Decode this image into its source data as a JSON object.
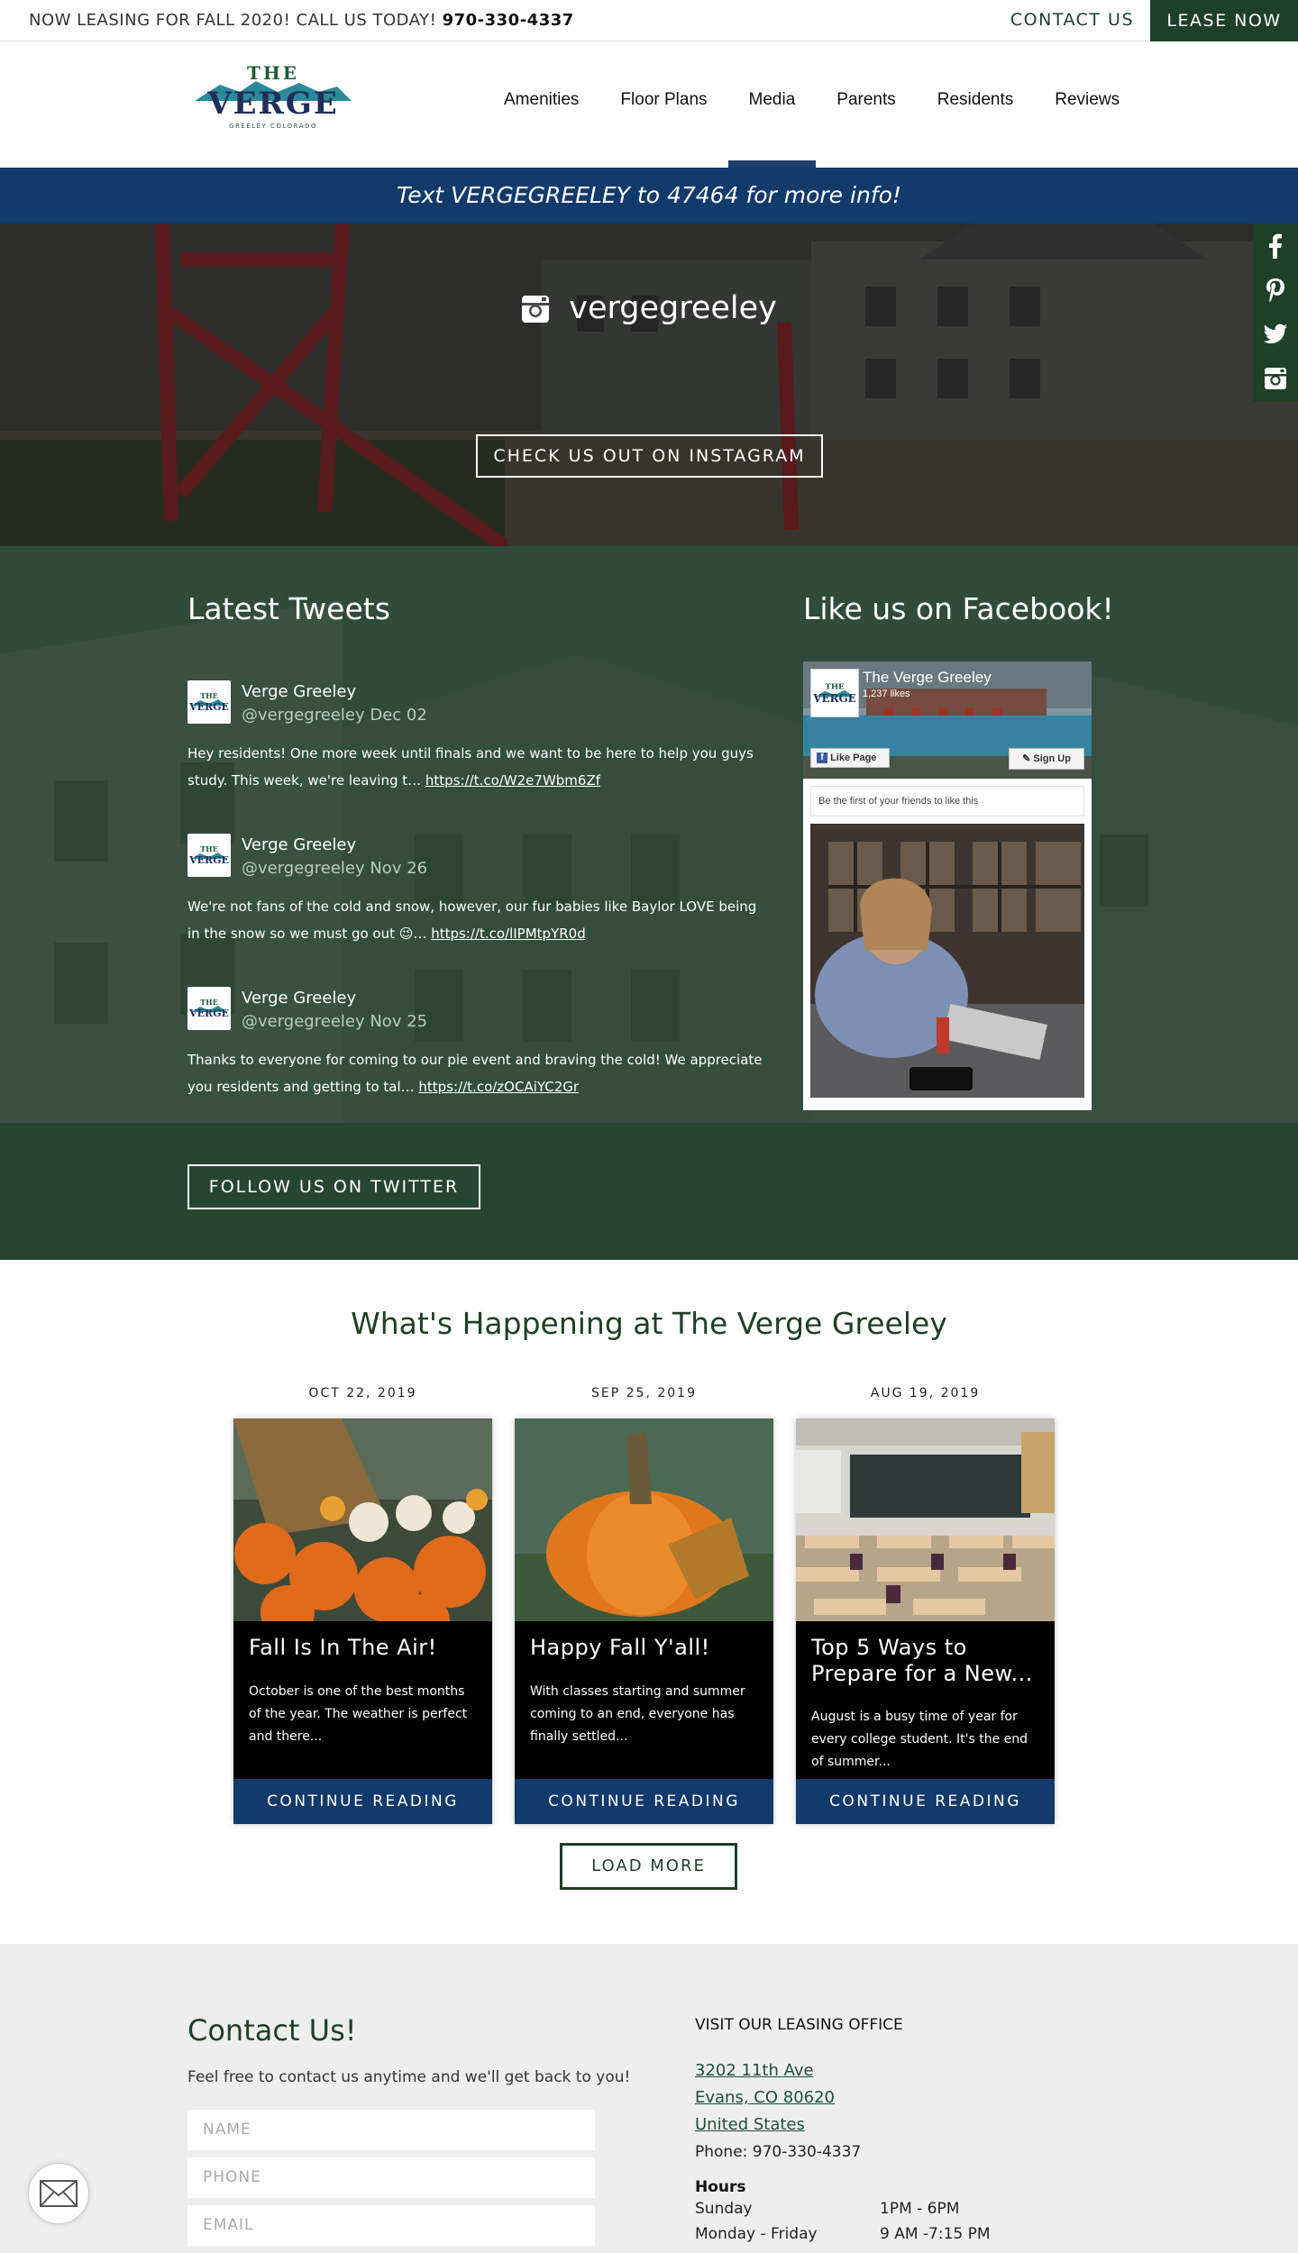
{
  "topbar": {
    "promo_text": "NOW LEASING FOR FALL 2020! CALL US TODAY!",
    "promo_phone": "970-330-4337",
    "contact_label": "CONTACT US",
    "lease_label": "LEASE NOW"
  },
  "logo": {
    "line1": "THE",
    "line2": "VERGE",
    "line3": "GREELEY COLORADO"
  },
  "nav": {
    "items": [
      "Amenities",
      "Floor Plans",
      "Media",
      "Parents",
      "Residents",
      "Reviews"
    ],
    "active": "Media"
  },
  "textbar": {
    "text": "Text VERGEGREELEY to 47464 for more info!"
  },
  "instagram": {
    "handle": "vergegreeley",
    "button_label": "CHECK US OUT ON INSTAGRAM"
  },
  "social": {
    "icons": [
      "facebook-icon",
      "pinterest-icon",
      "twitter-icon",
      "instagram-icon"
    ]
  },
  "tweets": {
    "heading": "Latest Tweets",
    "items": [
      {
        "name": "Verge Greeley",
        "handle": "@vergegreeley Dec 02",
        "text": "Hey residents! One more week until finals and we want to be here to help you guys study. This week, we're leaving t… ",
        "link": "https://t.co/W2e7Wbm6Zf"
      },
      {
        "name": "Verge Greeley",
        "handle": "@vergegreeley Nov 26",
        "text": "We're not fans of the cold and snow, however, our fur babies like Baylor LOVE being in the snow so we must go out 😉… ",
        "link": "https://t.co/lIPMtpYR0d"
      },
      {
        "name": "Verge Greeley",
        "handle": "@vergegreeley Nov 25",
        "text": "Thanks to everyone for coming to our pie event and braving the cold! We appreciate you residents and getting to tal… ",
        "link": "https://t.co/zOCAiYC2Gr"
      }
    ],
    "follow_label": "FOLLOW US ON TWITTER"
  },
  "facebook": {
    "heading": "Like us on Facebook!",
    "page_name": "The Verge Greeley",
    "likes": "1,237 likes",
    "like_label": "Like Page",
    "signup_label": "Sign Up",
    "friends_text": "Be the first of your friends to like this"
  },
  "news": {
    "heading": "What's Happening at The Verge Greeley",
    "posts": [
      {
        "date": "OCT 22, 2019",
        "title": "Fall Is In The Air!",
        "excerpt": "October is one of the best months of the year. The weather is perfect and there...",
        "cta": "CONTINUE READING"
      },
      {
        "date": "SEP 25, 2019",
        "title": "Happy Fall Y'all!",
        "excerpt": "With classes starting and summer coming to an end, everyone has finally settled...",
        "cta": "CONTINUE READING"
      },
      {
        "date": "AUG 19, 2019",
        "title": "Top 5 Ways to Prepare for a New...",
        "excerpt": "August is a busy time of year for every college student. It's the end of summer...",
        "cta": "CONTINUE READING"
      }
    ],
    "load_more": "LOAD MORE"
  },
  "contact": {
    "heading": "Contact Us!",
    "intro": "Feel free to contact us anytime and we'll get back to you!",
    "fields": {
      "name": "NAME",
      "phone": "PHONE",
      "email": "EMAIL"
    },
    "office_heading": "VISIT OUR LEASING OFFICE",
    "address": [
      "3202 11th Ave",
      "Evans, CO 80620",
      "United States"
    ],
    "phone": "Phone: 970-330-4337",
    "hours_heading": "Hours",
    "hours": [
      {
        "day": "Sunday",
        "time": "1PM - 6PM"
      },
      {
        "day": "Monday - Friday",
        "time": "9 AM -7:15 PM"
      }
    ]
  },
  "colors": {
    "green": "#1e3f28",
    "navy": "#123a6a",
    "light_gray": "#eeeeee"
  }
}
